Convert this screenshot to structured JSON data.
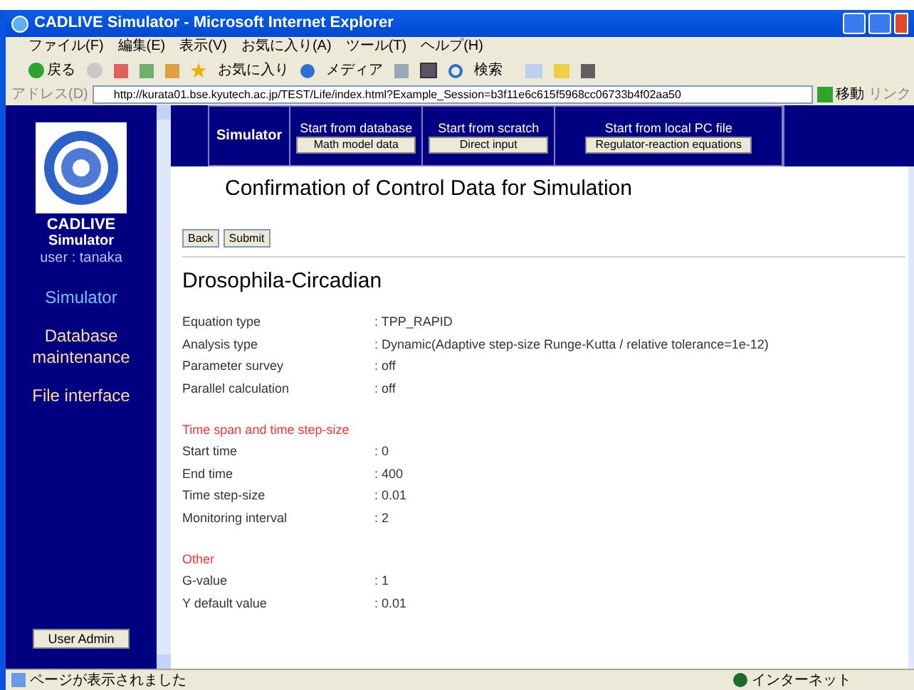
{
  "window": {
    "title": "CADLIVE Simulator - Microsoft Internet Explorer"
  },
  "menu": [
    "ファイル(F)",
    "編集(E)",
    "表示(V)",
    "お気に入り(A)",
    "ツール(T)",
    "ヘルプ(H)"
  ],
  "toolbar": {
    "back": "戻る",
    "favorites": "お気に入り",
    "media": "メディア",
    "search": "検索"
  },
  "address_bar": {
    "label": "アドレス(D)",
    "value": "http://kurata01.bse.kyutech.ac.jp/TEST/Life/index.html?Example_Session=b3f11e6c615f5968cc06733b4f02aa50",
    "go": "移動",
    "links": "リンク"
  },
  "sidebar": {
    "app_name": "CADLIVE",
    "app_sub": "Simulator",
    "user": "user : tanaka",
    "items": [
      {
        "label": "Simulator",
        "selected": true
      },
      {
        "label": "Database maintenance",
        "selected": false
      },
      {
        "label": "File interface",
        "selected": false
      }
    ],
    "admin_button": "User Admin"
  },
  "top_nav": {
    "current": "Simulator",
    "sections": [
      {
        "title": "Start from database",
        "button": "Math model data"
      },
      {
        "title": "Start from scratch",
        "button": "Direct input"
      },
      {
        "title": "Start from local PC file",
        "button": "Regulator-reaction equations"
      }
    ]
  },
  "page": {
    "heading": "Confirmation of Control Data for Simulation",
    "buttons": [
      "Back",
      "Submit"
    ],
    "model_name": "Drosophila-Circadian",
    "sections": [
      {
        "rows": [
          {
            "label": "Equation type",
            "value": ": TPP_RAPID"
          },
          {
            "label": "Analysis type",
            "value": ": Dynamic(Adaptive step-size Runge-Kutta / relative tolerance=1e-12)"
          },
          {
            "label": "Parameter survey",
            "value": ": off"
          },
          {
            "label": "Parallel calculation",
            "value": ": off"
          }
        ]
      },
      {
        "title": "Time span and time step-size",
        "rows": [
          {
            "label": "Start time",
            "value": ": 0"
          },
          {
            "label": "End time",
            "value": ": 400"
          },
          {
            "label": "Time step-size",
            "value": ": 0.01"
          },
          {
            "label": "Monitoring interval",
            "value": ": 2"
          }
        ]
      },
      {
        "title": "Other",
        "rows": [
          {
            "label": "G-value",
            "value": ": 1"
          },
          {
            "label": "Y default value",
            "value": ": 0.01"
          }
        ]
      }
    ]
  },
  "status_bar": {
    "message": "ページが表示されました",
    "zone": "インターネット"
  }
}
